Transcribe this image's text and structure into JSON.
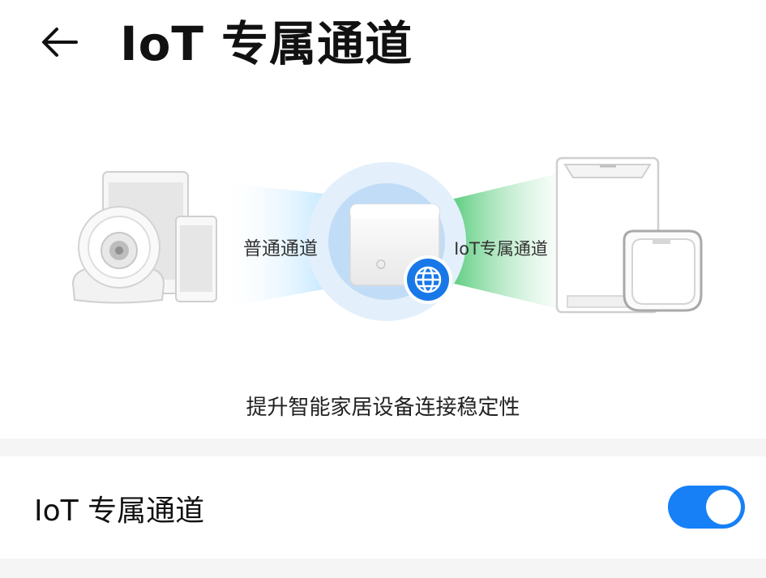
{
  "header": {
    "title": "IoT 专属通道"
  },
  "illustration": {
    "normal_channel_label": "普通通道",
    "iot_channel_label": "IoT专属通道",
    "caption": "提升智能家居设备连接稳定性"
  },
  "setting": {
    "label": "IoT 专属通道",
    "enabled": true
  },
  "colors": {
    "accent": "#1780f7",
    "normal_beam": "#bfe6ff",
    "iot_beam": "#3fc46a"
  }
}
